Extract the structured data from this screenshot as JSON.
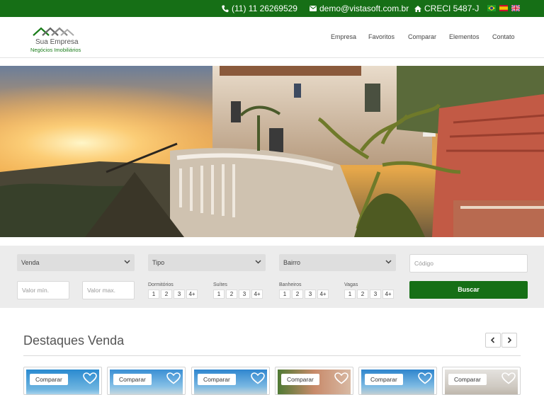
{
  "topbar": {
    "phone": "(11) 11 26269529",
    "email": "demo@vistasoft.com.br",
    "creci": "CRECI 5487-J",
    "flags": [
      "brazil-flag",
      "spain-flag",
      "uk-flag"
    ],
    "bg_color": "#166f16"
  },
  "logo": {
    "name": "Sua Empresa",
    "subtitle": "Negócios Imobiliários"
  },
  "nav": {
    "items": [
      "Empresa",
      "Favoritos",
      "Comparar",
      "Elementos",
      "Contato"
    ]
  },
  "search": {
    "selects": {
      "operation": "Venda",
      "type": "Tipo",
      "district": "Bairro"
    },
    "code_placeholder": "Código",
    "min_placeholder": "Valor mín.",
    "max_placeholder": "Valor max.",
    "groups": [
      {
        "label": "Dormitórios",
        "options": [
          "1",
          "2",
          "3",
          "4+"
        ]
      },
      {
        "label": "Suítes",
        "options": [
          "1",
          "2",
          "3",
          "4+"
        ]
      },
      {
        "label": "Banheiros",
        "options": [
          "1",
          "2",
          "3",
          "4+"
        ]
      },
      {
        "label": "Vagas",
        "options": [
          "1",
          "2",
          "3",
          "4+"
        ]
      }
    ],
    "button": "Buscar"
  },
  "featured": {
    "title": "Destaques Venda",
    "compare_label": "Comparar",
    "prev_icon": "chevron-left-icon",
    "next_icon": "chevron-right-icon"
  },
  "colors": {
    "brand_green": "#166f16",
    "panel_gray": "#ececec"
  }
}
